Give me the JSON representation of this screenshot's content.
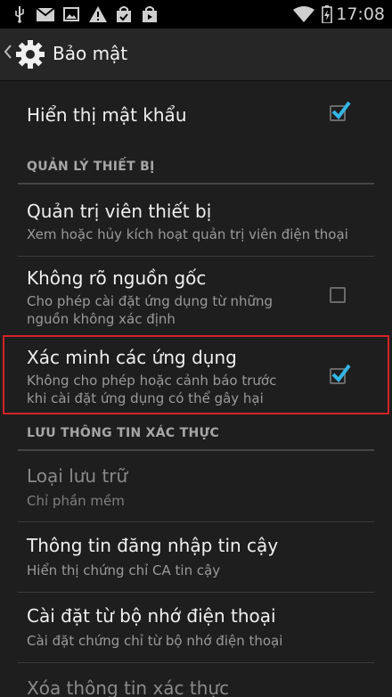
{
  "status_bar": {
    "time": "17:08",
    "icons": [
      "usb-icon",
      "gmail-icon",
      "gallery-icon",
      "warning-icon",
      "bag-icon",
      "play-store-icon",
      "wifi-icon",
      "battery-icon"
    ]
  },
  "action_bar": {
    "title": "Bảo mật",
    "icon": "gear-icon"
  },
  "items": {
    "show_password": {
      "title": "Hiển thị mật khẩu",
      "checked": true
    },
    "section_device": "QUẢN LÝ THIẾT BỊ",
    "device_admin": {
      "title": "Quản trị viên thiết bị",
      "summary": "Xem hoặc hủy kích hoạt quản trị viên điện thoại"
    },
    "unknown_sources": {
      "title": "Không rõ nguồn gốc",
      "summary1": "Cho phép cài đặt ứng dụng từ những",
      "summary2": "nguồn không xác định",
      "checked": false
    },
    "verify_apps": {
      "title": "Xác minh các ứng dụng",
      "summary1": "Không cho phép hoặc cảnh báo trước",
      "summary2": "khi cài đặt ứng dụng có thể gây hại",
      "checked": true
    },
    "section_credentials": "LƯU THÔNG TIN XÁC THỰC",
    "storage_type": {
      "title": "Loại lưu trữ",
      "summary": "Chỉ phần mềm"
    },
    "trusted_credentials": {
      "title": "Thông tin đăng nhập tin cậy",
      "summary": "Hiển thị chứng chỉ CA tin cậy"
    },
    "install_from_storage": {
      "title": "Cài đặt từ bộ nhớ điện thoại",
      "summary": "Cài đặt chứng chỉ từ bộ nhớ điện thoại"
    },
    "clear_credentials": {
      "title": "Xóa thông tin xác thực"
    }
  },
  "colors": {
    "accent": "#33b5e5",
    "highlight": "#d2232a"
  }
}
